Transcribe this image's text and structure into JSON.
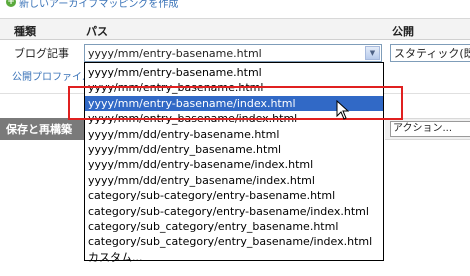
{
  "top_link": {
    "text": "新しいアーカイブマッピングを作成"
  },
  "table": {
    "headers": {
      "type": "種類",
      "path": "パス",
      "publish": "公開"
    },
    "row": {
      "type": "ブログ記事",
      "path_value": "yyyy/mm/entry-basename.html",
      "publish_value": "スタティック(既"
    }
  },
  "profile_link": "公開プロファイル",
  "save_bar": {
    "label": "保存と再構築",
    "action_select": "アクション..."
  },
  "dropdown": {
    "options": [
      "yyyy/mm/entry-basename.html",
      "yyyy/mm/entry_basename.html",
      "yyyy/mm/entry-basename/index.html",
      "yyyy/mm/entry_basename/index.html",
      "yyyy/mm/dd/entry-basename.html",
      "yyyy/mm/dd/entry_basename.html",
      "yyyy/mm/dd/entry-basename/index.html",
      "yyyy/mm/dd/entry_basename/index.html",
      "category/sub-category/entry-basename.html",
      "category/sub-category/entry-basename/index.html",
      "category/sub_category/entry_basename.html",
      "category/sub_category/entry_basename/index.html",
      "カスタム..."
    ],
    "selected_index": 2
  },
  "colors": {
    "selection": "#3169c6",
    "highlight": "#e02020",
    "link": "#3a73b8"
  }
}
